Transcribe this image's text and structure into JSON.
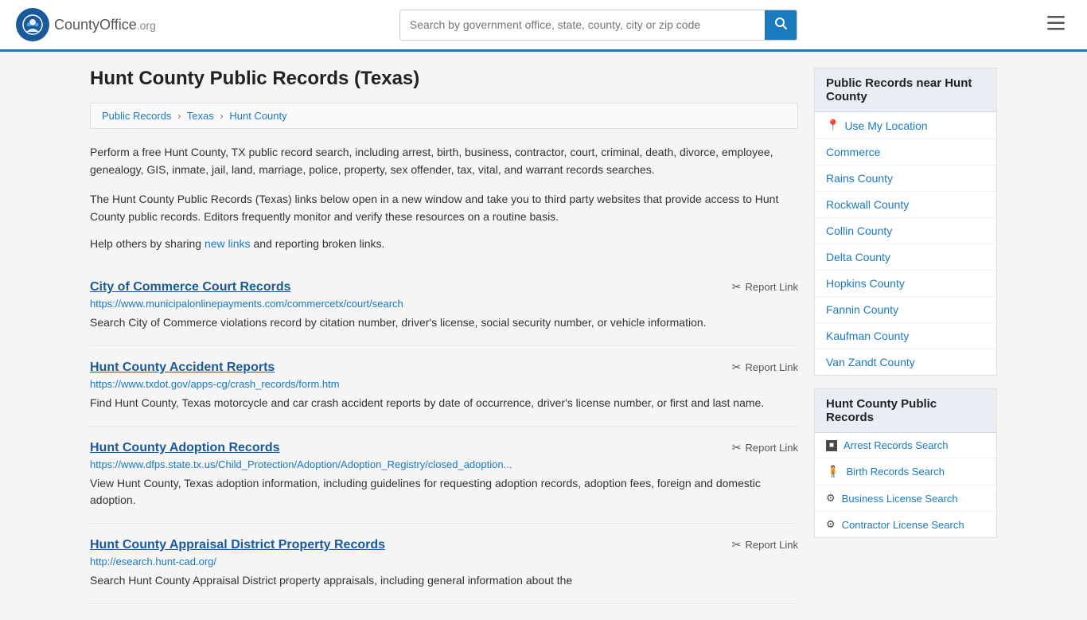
{
  "header": {
    "logo_text": "CountyOffice",
    "logo_org": ".org",
    "search_placeholder": "Search by government office, state, county, city or zip code"
  },
  "page": {
    "title": "Hunt County Public Records (Texas)",
    "breadcrumb": [
      {
        "label": "Public Records",
        "href": "#"
      },
      {
        "label": "Texas",
        "href": "#"
      },
      {
        "label": "Hunt County",
        "href": "#"
      }
    ],
    "intro1": "Perform a free Hunt County, TX public record search, including arrest, birth, business, contractor, court, criminal, death, divorce, employee, genealogy, GIS, inmate, jail, land, marriage, police, property, sex offender, tax, vital, and warrant records searches.",
    "intro2": "The Hunt County Public Records (Texas) links below open in a new window and take you to third party websites that provide access to Hunt County public records. Editors frequently monitor and verify these resources on a routine basis.",
    "share_text_pre": "Help others by sharing ",
    "share_link": "new links",
    "share_text_post": " and reporting broken links."
  },
  "records": [
    {
      "title": "City of Commerce Court Records",
      "url": "https://www.municipalonlinepayments.com/commercetx/court/search",
      "desc": "Search City of Commerce violations record by citation number, driver's license, social security number, or vehicle information.",
      "report_label": "Report Link"
    },
    {
      "title": "Hunt County Accident Reports",
      "url": "https://www.txdot.gov/apps-cg/crash_records/form.htm",
      "desc": "Find Hunt County, Texas motorcycle and car crash accident reports by date of occurrence, driver's license number, or first and last name.",
      "report_label": "Report Link"
    },
    {
      "title": "Hunt County Adoption Records",
      "url": "https://www.dfps.state.tx.us/Child_Protection/Adoption/Adoption_Registry/closed_adoption...",
      "desc": "View Hunt County, Texas adoption information, including guidelines for requesting adoption records, adoption fees, foreign and domestic adoption.",
      "report_label": "Report Link"
    },
    {
      "title": "Hunt County Appraisal District Property Records",
      "url": "http://esearch.hunt-cad.org/",
      "desc": "Search Hunt County Appraisal District property appraisals, including general information about the",
      "report_label": "Report Link"
    }
  ],
  "sidebar": {
    "nearby_header": "Public Records near Hunt County",
    "use_location_label": "Use My Location",
    "nearby_links": [
      "Commerce",
      "Rains County",
      "Rockwall County",
      "Collin County",
      "Delta County",
      "Hopkins County",
      "Fannin County",
      "Kaufman County",
      "Van Zandt County"
    ],
    "records_header": "Hunt County Public Records",
    "record_links": [
      {
        "label": "Arrest Records Search",
        "icon": "square"
      },
      {
        "label": "Birth Records Search",
        "icon": "person"
      },
      {
        "label": "Business License Search",
        "icon": "gear"
      },
      {
        "label": "Contractor License Search",
        "icon": "gear"
      }
    ]
  }
}
